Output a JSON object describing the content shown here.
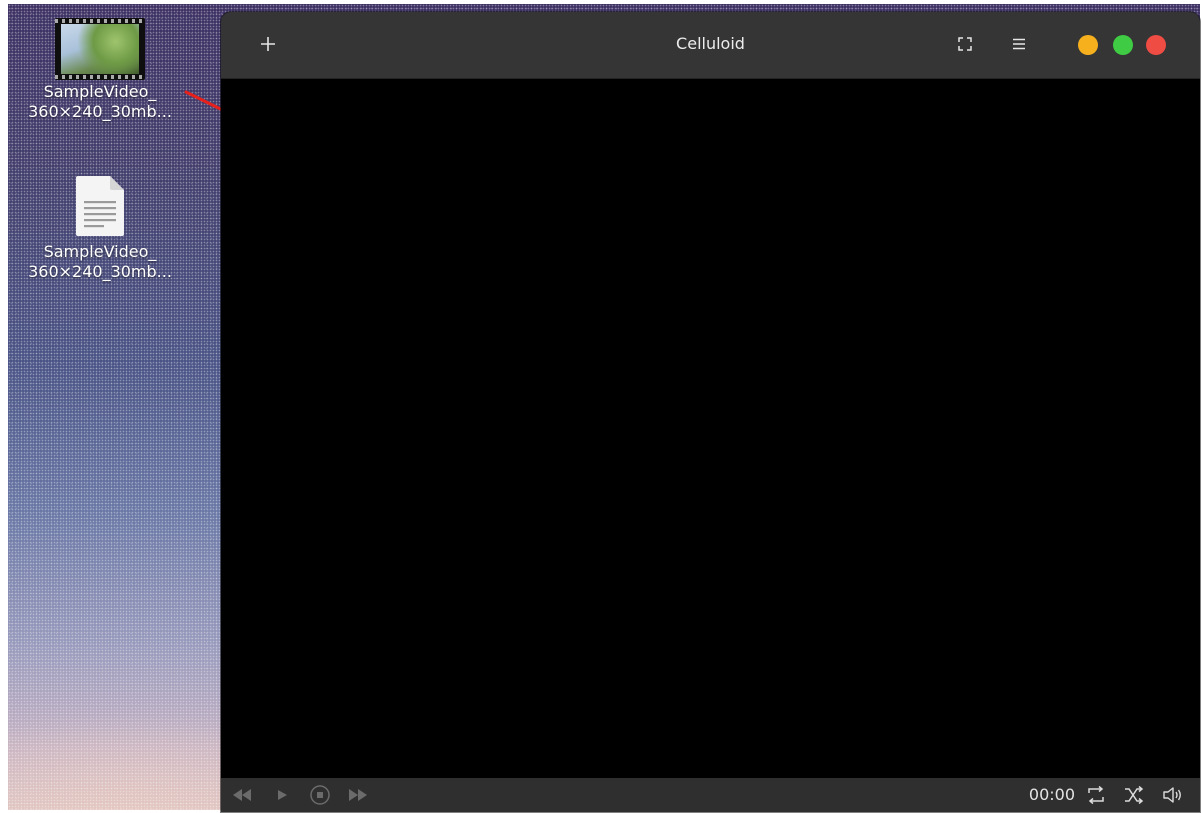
{
  "desktop": {
    "icons": [
      {
        "name": "SampleVideo_",
        "name_line2": "360×240_30mb...",
        "type": "video-file-icon"
      },
      {
        "name": "SampleVideo_",
        "name_line2": "360×240_30mb...",
        "type": "text-document-icon"
      }
    ]
  },
  "window": {
    "title": "Celluloid",
    "header_icons": {
      "add": "plus-icon",
      "fullscreen": "fullscreen-icon",
      "menu": "hamburger-menu-icon"
    },
    "window_controls": {
      "minimize_color": "#f6b01e",
      "maximize_color": "#3fcb43",
      "close_color": "#ef4c44"
    },
    "controls": {
      "time": "00:00",
      "icons": [
        "rewind-icon",
        "play-icon",
        "stop-icon",
        "fast-forward-icon",
        "loop-icon",
        "shuffle-icon",
        "volume-icon"
      ]
    }
  },
  "annotation": {
    "color": "#e8201c",
    "icon": "red-arrow"
  }
}
